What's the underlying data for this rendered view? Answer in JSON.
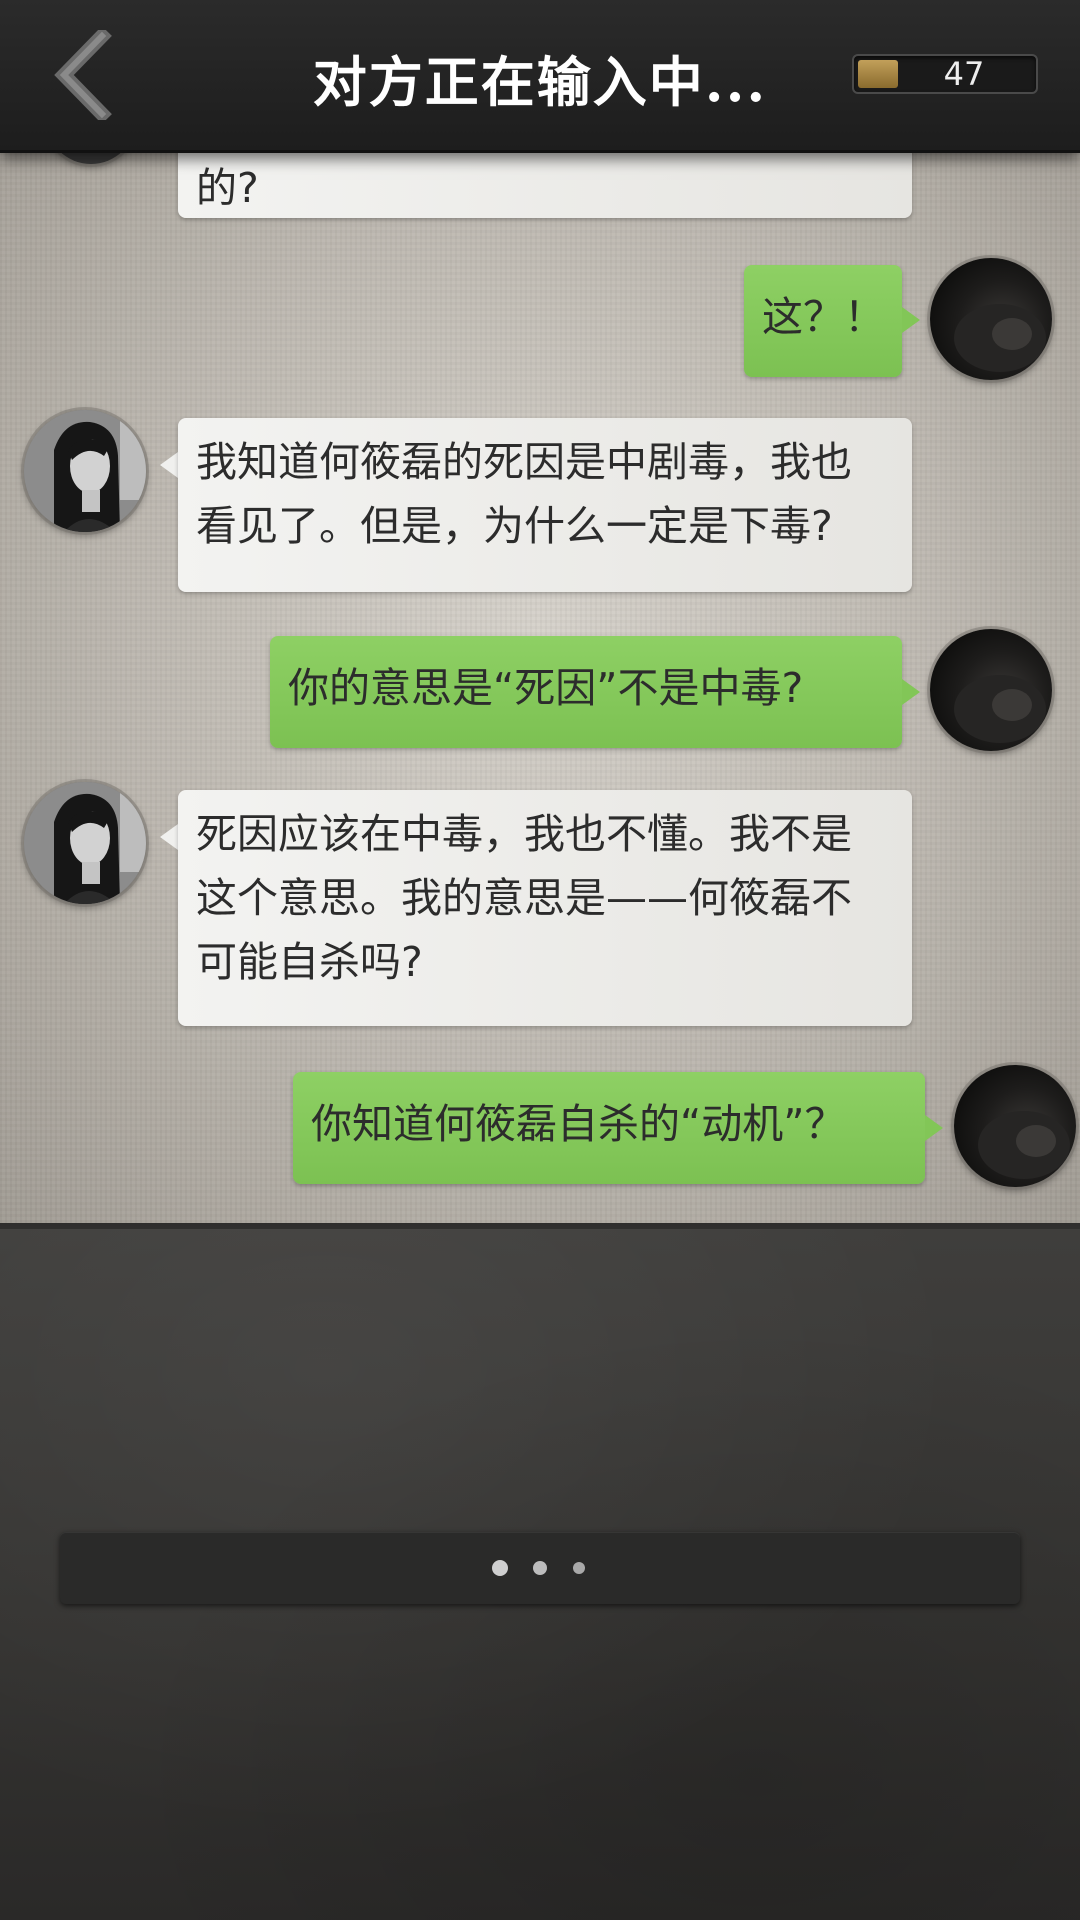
{
  "header": {
    "title": "对方正在输入中...",
    "coin_count": "47",
    "back_icon": "chevron-left-icon"
  },
  "messages": [
    {
      "side": "in",
      "text": "的?"
    },
    {
      "side": "out",
      "text": "这？！"
    },
    {
      "side": "in",
      "lines": [
        "我知道何筱磊的死因是中剧毒，我也",
        "看见了。但是，为什么一定是下毒?"
      ]
    },
    {
      "side": "out",
      "text": "你的意思是“死因”不是中毒?"
    },
    {
      "side": "in",
      "lines": [
        "死因应该在中毒，我也不懂。我不是",
        "这个意思。我的意思是——何筱磊不",
        "可能自杀吗?"
      ]
    },
    {
      "side": "out",
      "text": "你知道何筱磊自杀的“动机”？"
    }
  ],
  "typing_indicator": {
    "dots": 3
  },
  "colors": {
    "outgoing_bubble": "#84c75a",
    "incoming_bubble": "#eeeeec",
    "top_bar": "#222222",
    "coin": "#b08f4b"
  }
}
